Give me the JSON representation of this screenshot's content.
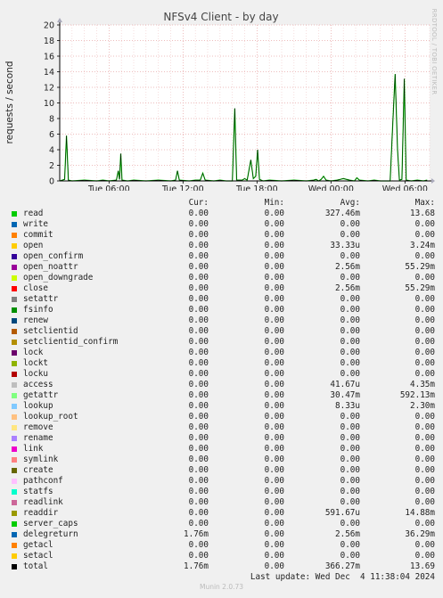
{
  "title": "NFSv4 Client - by day",
  "side_label": "RRDTOOL / TOBI OETIKER",
  "footer": "Munin 2.0.73",
  "legend_headers": {
    "cur": "Cur:",
    "min": "Min:",
    "avg": "Avg:",
    "max": "Max:"
  },
  "last_update": "Last update: Wed Dec  4 11:38:04 2024",
  "legend": [
    {
      "name": "read",
      "color": "#00cc00",
      "cur": "0.00",
      "min": "0.00",
      "avg": "327.46m",
      "max": "13.68"
    },
    {
      "name": "write",
      "color": "#0066b3",
      "cur": "0.00",
      "min": "0.00",
      "avg": "0.00",
      "max": "0.00"
    },
    {
      "name": "commit",
      "color": "#ff8000",
      "cur": "0.00",
      "min": "0.00",
      "avg": "0.00",
      "max": "0.00"
    },
    {
      "name": "open",
      "color": "#ffcc00",
      "cur": "0.00",
      "min": "0.00",
      "avg": "33.33u",
      "max": "3.24m"
    },
    {
      "name": "open_confirm",
      "color": "#330099",
      "cur": "0.00",
      "min": "0.00",
      "avg": "0.00",
      "max": "0.00"
    },
    {
      "name": "open_noattr",
      "color": "#990099",
      "cur": "0.00",
      "min": "0.00",
      "avg": "2.56m",
      "max": "55.29m"
    },
    {
      "name": "open_downgrade",
      "color": "#ccff00",
      "cur": "0.00",
      "min": "0.00",
      "avg": "0.00",
      "max": "0.00"
    },
    {
      "name": "close",
      "color": "#ff0000",
      "cur": "0.00",
      "min": "0.00",
      "avg": "2.56m",
      "max": "55.29m"
    },
    {
      "name": "setattr",
      "color": "#808080",
      "cur": "0.00",
      "min": "0.00",
      "avg": "0.00",
      "max": "0.00"
    },
    {
      "name": "fsinfo",
      "color": "#008f00",
      "cur": "0.00",
      "min": "0.00",
      "avg": "0.00",
      "max": "0.00"
    },
    {
      "name": "renew",
      "color": "#00487d",
      "cur": "0.00",
      "min": "0.00",
      "avg": "0.00",
      "max": "0.00"
    },
    {
      "name": "setclientid",
      "color": "#b35a00",
      "cur": "0.00",
      "min": "0.00",
      "avg": "0.00",
      "max": "0.00"
    },
    {
      "name": "setclientid_confirm",
      "color": "#b38f00",
      "cur": "0.00",
      "min": "0.00",
      "avg": "0.00",
      "max": "0.00"
    },
    {
      "name": "lock",
      "color": "#6b006b",
      "cur": "0.00",
      "min": "0.00",
      "avg": "0.00",
      "max": "0.00"
    },
    {
      "name": "lockt",
      "color": "#8fb300",
      "cur": "0.00",
      "min": "0.00",
      "avg": "0.00",
      "max": "0.00"
    },
    {
      "name": "locku",
      "color": "#b30000",
      "cur": "0.00",
      "min": "0.00",
      "avg": "0.00",
      "max": "0.00"
    },
    {
      "name": "access",
      "color": "#bebebe",
      "cur": "0.00",
      "min": "0.00",
      "avg": "41.67u",
      "max": "4.35m"
    },
    {
      "name": "getattr",
      "color": "#80ff80",
      "cur": "0.00",
      "min": "0.00",
      "avg": "30.47m",
      "max": "592.13m"
    },
    {
      "name": "lookup",
      "color": "#80c9ff",
      "cur": "0.00",
      "min": "0.00",
      "avg": "8.33u",
      "max": "2.30m"
    },
    {
      "name": "lookup_root",
      "color": "#ffc080",
      "cur": "0.00",
      "min": "0.00",
      "avg": "0.00",
      "max": "0.00"
    },
    {
      "name": "remove",
      "color": "#ffe680",
      "cur": "0.00",
      "min": "0.00",
      "avg": "0.00",
      "max": "0.00"
    },
    {
      "name": "rename",
      "color": "#aa80ff",
      "cur": "0.00",
      "min": "0.00",
      "avg": "0.00",
      "max": "0.00"
    },
    {
      "name": "link",
      "color": "#ee00cc",
      "cur": "0.00",
      "min": "0.00",
      "avg": "0.00",
      "max": "0.00"
    },
    {
      "name": "symlink",
      "color": "#ff8080",
      "cur": "0.00",
      "min": "0.00",
      "avg": "0.00",
      "max": "0.00"
    },
    {
      "name": "create",
      "color": "#666600",
      "cur": "0.00",
      "min": "0.00",
      "avg": "0.00",
      "max": "0.00"
    },
    {
      "name": "pathconf",
      "color": "#ffbfff",
      "cur": "0.00",
      "min": "0.00",
      "avg": "0.00",
      "max": "0.00"
    },
    {
      "name": "statfs",
      "color": "#00ffcc",
      "cur": "0.00",
      "min": "0.00",
      "avg": "0.00",
      "max": "0.00"
    },
    {
      "name": "readlink",
      "color": "#cc6699",
      "cur": "0.00",
      "min": "0.00",
      "avg": "0.00",
      "max": "0.00"
    },
    {
      "name": "readdir",
      "color": "#999900",
      "cur": "0.00",
      "min": "0.00",
      "avg": "591.67u",
      "max": "14.88m"
    },
    {
      "name": "server_caps",
      "color": "#00cc00",
      "cur": "0.00",
      "min": "0.00",
      "avg": "0.00",
      "max": "0.00"
    },
    {
      "name": "delegreturn",
      "color": "#0066b3",
      "cur": "1.76m",
      "min": "0.00",
      "avg": "2.56m",
      "max": "36.29m"
    },
    {
      "name": "getacl",
      "color": "#ff8000",
      "cur": "0.00",
      "min": "0.00",
      "avg": "0.00",
      "max": "0.00"
    },
    {
      "name": "setacl",
      "color": "#ffcc00",
      "cur": "0.00",
      "min": "0.00",
      "avg": "0.00",
      "max": "0.00"
    },
    {
      "name": "total",
      "color": "#000000",
      "cur": "1.76m",
      "min": "0.00",
      "avg": "366.27m",
      "max": "13.69"
    }
  ],
  "chart_data": {
    "type": "line",
    "title": "NFSv4 Client - by day",
    "ylabel": "requests / second",
    "xlabel": "",
    "ylim": [
      0,
      20
    ],
    "yticks": [
      0,
      2,
      4,
      6,
      8,
      10,
      12,
      14,
      16,
      18,
      20
    ],
    "xlim_hours": [
      2,
      32
    ],
    "xticks": [
      {
        "label": "Tue 06:00",
        "hour": 6
      },
      {
        "label": "Tue 12:00",
        "hour": 12
      },
      {
        "label": "Tue 18:00",
        "hour": 18
      },
      {
        "label": "Wed 00:00",
        "hour": 24
      },
      {
        "label": "Wed 06:00",
        "hour": 30
      }
    ],
    "grid": true,
    "series": [
      {
        "name": "read",
        "color": "#00cc00",
        "points": [
          [
            2.0,
            0.0
          ],
          [
            2.4,
            0.2
          ],
          [
            2.55,
            5.8
          ],
          [
            2.7,
            0.1
          ],
          [
            3.0,
            0.0
          ],
          [
            4.0,
            0.1
          ],
          [
            5.0,
            0.0
          ],
          [
            5.5,
            0.1
          ],
          [
            6.0,
            0.0
          ],
          [
            6.6,
            0.1
          ],
          [
            6.75,
            1.3
          ],
          [
            6.85,
            0.2
          ],
          [
            6.95,
            3.5
          ],
          [
            7.05,
            0.1
          ],
          [
            7.5,
            0.0
          ],
          [
            8.0,
            0.1
          ],
          [
            9.0,
            0.0
          ],
          [
            10.0,
            0.1
          ],
          [
            11.0,
            0.0
          ],
          [
            11.4,
            0.1
          ],
          [
            11.55,
            1.3
          ],
          [
            11.7,
            0.1
          ],
          [
            12.5,
            0.0
          ],
          [
            13.0,
            0.1
          ],
          [
            13.4,
            0.1
          ],
          [
            13.6,
            1.0
          ],
          [
            13.8,
            0.1
          ],
          [
            14.5,
            0.0
          ],
          [
            15.0,
            0.1
          ],
          [
            15.5,
            0.0
          ],
          [
            16.0,
            0.0
          ],
          [
            16.2,
            9.3
          ],
          [
            16.35,
            0.1
          ],
          [
            16.8,
            0.1
          ],
          [
            17.0,
            0.3
          ],
          [
            17.2,
            0.1
          ],
          [
            17.5,
            2.7
          ],
          [
            17.7,
            0.3
          ],
          [
            17.9,
            0.6
          ],
          [
            18.05,
            4.0
          ],
          [
            18.2,
            0.2
          ],
          [
            18.5,
            0.0
          ],
          [
            19.0,
            0.1
          ],
          [
            20.0,
            0.0
          ],
          [
            21.0,
            0.1
          ],
          [
            22.0,
            0.0
          ],
          [
            22.6,
            0.1
          ],
          [
            22.8,
            0.2
          ],
          [
            23.0,
            0.0
          ],
          [
            23.2,
            0.2
          ],
          [
            23.4,
            0.6
          ],
          [
            23.6,
            0.1
          ],
          [
            24.0,
            0.0
          ],
          [
            24.5,
            0.1
          ],
          [
            25.0,
            0.3
          ],
          [
            25.5,
            0.1
          ],
          [
            25.9,
            0.0
          ],
          [
            26.1,
            0.4
          ],
          [
            26.3,
            0.1
          ],
          [
            27.0,
            0.0
          ],
          [
            27.5,
            0.1
          ],
          [
            28.0,
            0.0
          ],
          [
            28.8,
            0.0
          ],
          [
            29.0,
            7.0
          ],
          [
            29.2,
            13.7
          ],
          [
            29.4,
            4.0
          ],
          [
            29.55,
            0.1
          ],
          [
            29.75,
            0.2
          ],
          [
            29.95,
            13.1
          ],
          [
            30.1,
            0.1
          ],
          [
            30.5,
            0.0
          ],
          [
            31.0,
            0.1
          ],
          [
            31.5,
            0.0
          ],
          [
            31.8,
            0.1
          ],
          [
            32.05,
            2.6
          ],
          [
            32.25,
            0.1
          ],
          [
            32.5,
            0.0
          ],
          [
            33.5,
            0.0
          ],
          [
            34.0,
            0.0
          ]
        ]
      }
    ]
  }
}
